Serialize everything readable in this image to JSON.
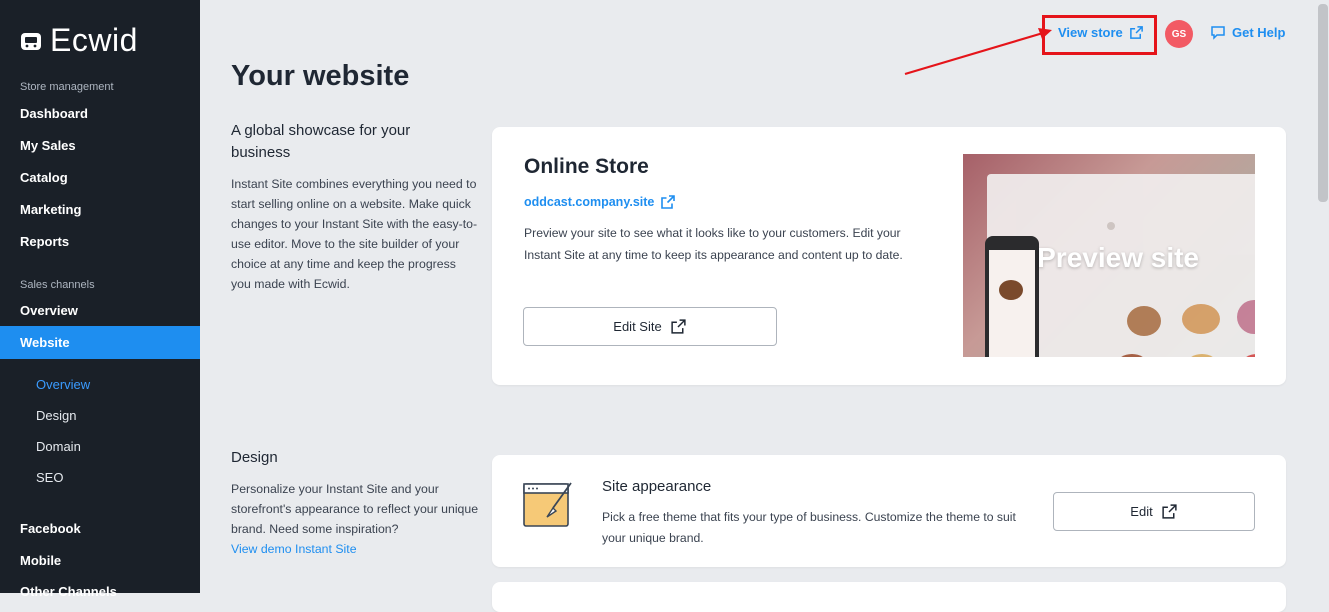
{
  "sidebar": {
    "logo": "Ecwid",
    "section_store": "Store management",
    "store_items": [
      "Dashboard",
      "My Sales",
      "Catalog",
      "Marketing",
      "Reports"
    ],
    "section_sales": "Sales channels",
    "sales_items": [
      "Overview",
      "Website"
    ],
    "active_item": "Website",
    "sub_items": [
      "Overview",
      "Design",
      "Domain",
      "SEO"
    ],
    "active_sub": "Overview",
    "more_items": [
      "Facebook",
      "Mobile",
      "Other Channels"
    ]
  },
  "topbar": {
    "view_store": "View store",
    "avatar_initials": "GS",
    "get_help": "Get Help",
    "highlight_color": "#e5141a"
  },
  "page": {
    "title": "Your website"
  },
  "showcase": {
    "heading": "A global showcase for your business",
    "body": "Instant Site combines everything you need to start selling online on a website. Make quick changes to your Instant Site with the easy-to-use editor. Move to the site builder of your choice at any time and keep the progress you made with Ecwid."
  },
  "online_store": {
    "title": "Online Store",
    "url": "oddcast.company.site",
    "description": "Preview your site to see what it looks like to your customers. Edit your Instant Site at any time to keep its appearance and content up to date.",
    "edit_button": "Edit Site",
    "preview_label": "Preview site"
  },
  "design": {
    "heading": "Design",
    "body": "Personalize your Instant Site and your storefront's appearance to reflect your unique brand. Need some inspiration?",
    "demo_link": "View demo Instant Site"
  },
  "site_appearance": {
    "title": "Site appearance",
    "description": "Pick a free theme that fits your type of business. Customize the theme to suit your unique brand.",
    "edit_button": "Edit"
  },
  "colors": {
    "accent": "#1e8ef0",
    "sidebar_bg": "#1a2028",
    "avatar_bg": "#f25a64"
  },
  "icons": {
    "external_link": "external-link-icon",
    "chat": "chat-icon",
    "logo": "cart-logo-icon",
    "theme": "paintbrush-window-icon"
  }
}
